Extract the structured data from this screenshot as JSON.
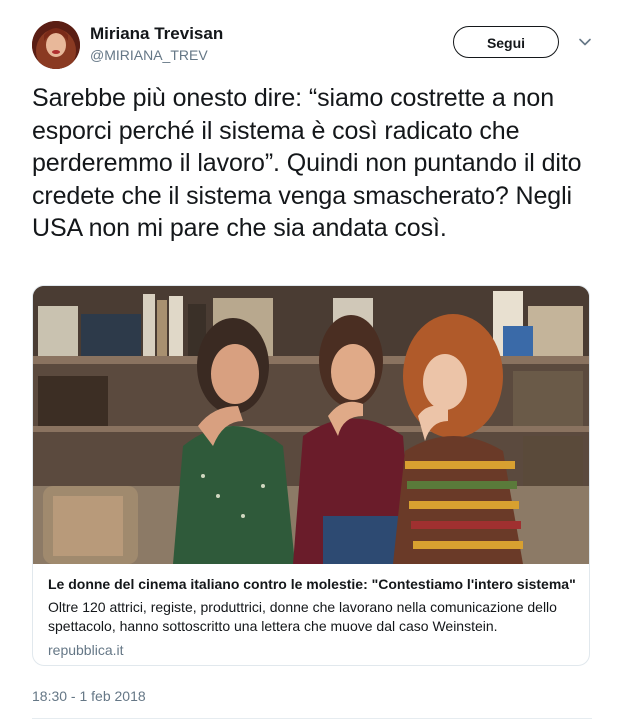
{
  "user": {
    "name": "Miriana Trevisan",
    "handle": "@MIRIANA_TREV",
    "follow_label": "Segui"
  },
  "tweet": {
    "text": "Sarebbe più onesto dire: “siamo costrette a non esporci perché il sistema è così radicato che perderemmo il lavoro”. Quindi non puntando il dito credete che il sistema venga smascherato? Negli USA non mi pare che sia andata così.",
    "timestamp": "18:30 - 1 feb 2018"
  },
  "card": {
    "title": "Le donne del cinema italiano contro le molestie: \"Contestiamo l'intero sistema\"",
    "description": "Oltre 120 attrici, registe, produttrici, donne che lavorano nella comunicazione dello spettacolo, hanno sottoscritto una lettera che muove dal caso Weinstein.",
    "domain": "repubblica.it"
  },
  "icons": {
    "more": "chevron-down-icon"
  },
  "colors": {
    "text": "#14171a",
    "secondary": "#657786",
    "border": "#e1e8ed"
  }
}
